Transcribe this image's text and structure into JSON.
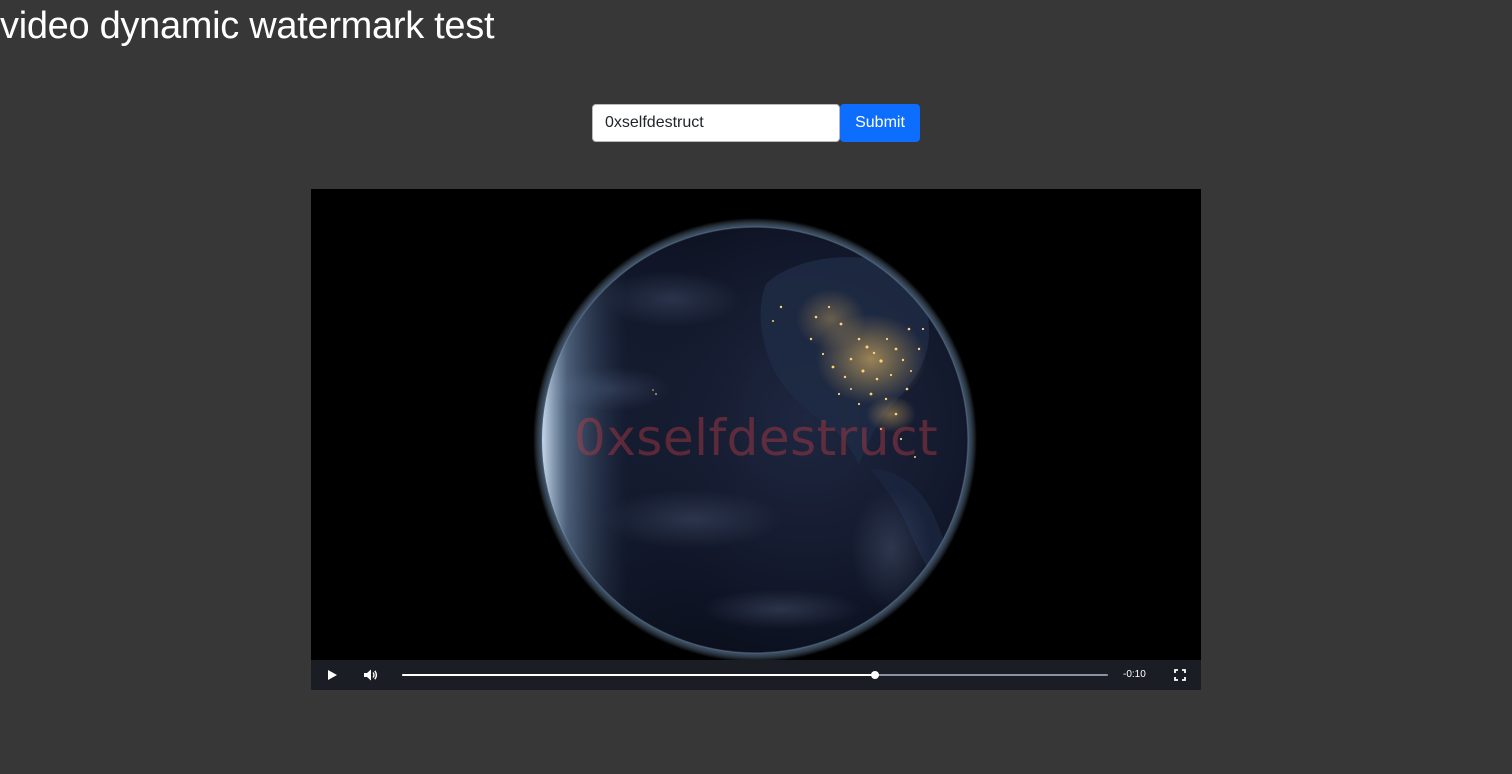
{
  "page": {
    "title": "video dynamic watermark test"
  },
  "form": {
    "input_value": "0xselfdestruct",
    "submit_label": "Submit"
  },
  "player": {
    "watermark_text": "0xselfdestruct",
    "progress_fraction": 0.67,
    "time_remaining": "-0:10",
    "icons": {
      "play": "play-icon",
      "volume": "volume-icon",
      "fullscreen": "fullscreen-icon"
    }
  },
  "colors": {
    "page_background": "#373737",
    "button_primary": "#0d6efd",
    "control_bar": "#1a1d24",
    "watermark": "#be3c46"
  }
}
